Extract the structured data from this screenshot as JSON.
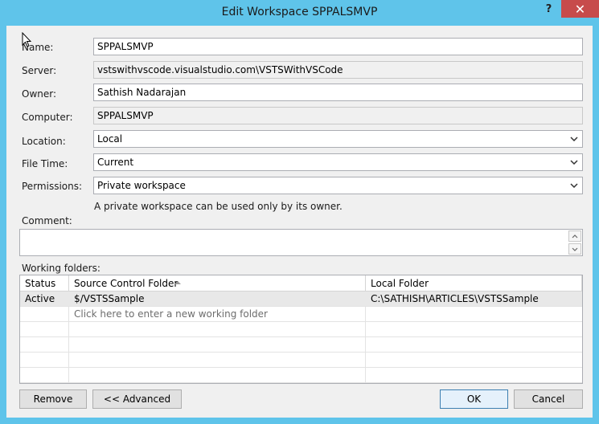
{
  "window": {
    "title": "Edit Workspace SPPALSMVP",
    "help_label": "?",
    "close_label": "✕"
  },
  "form": {
    "name_label": "Name:",
    "name_value": "SPPALSMVP",
    "server_label": "Server:",
    "server_value": "vstswithvscode.visualstudio.com\\VSTSWithVSCode",
    "owner_label": "Owner:",
    "owner_value": "Sathish Nadarajan",
    "computer_label": "Computer:",
    "computer_value": "SPPALSMVP",
    "location_label": "Location:",
    "location_value": "Local",
    "filetime_label": "File Time:",
    "filetime_value": "Current",
    "permissions_label": "Permissions:",
    "permissions_value": "Private workspace",
    "permissions_hint": "A private workspace can be used only by its owner.",
    "comment_label": "Comment:",
    "comment_value": ""
  },
  "working_folders": {
    "label": "Working folders:",
    "columns": [
      "Status",
      "Source Control Folder",
      "Local Folder"
    ],
    "rows": [
      {
        "status": "Active",
        "source": "$/VSTSSample",
        "local": "C:\\SATHISH\\ARTICLES\\VSTSSample"
      }
    ],
    "new_row_prompt": "Click here to enter a new working folder"
  },
  "buttons": {
    "remove": "Remove",
    "advanced": "<< Advanced",
    "ok": "OK",
    "cancel": "Cancel"
  },
  "colors": {
    "titlebar": "#5fc4ea",
    "close": "#c74b4b",
    "client": "#f0f0f0"
  }
}
